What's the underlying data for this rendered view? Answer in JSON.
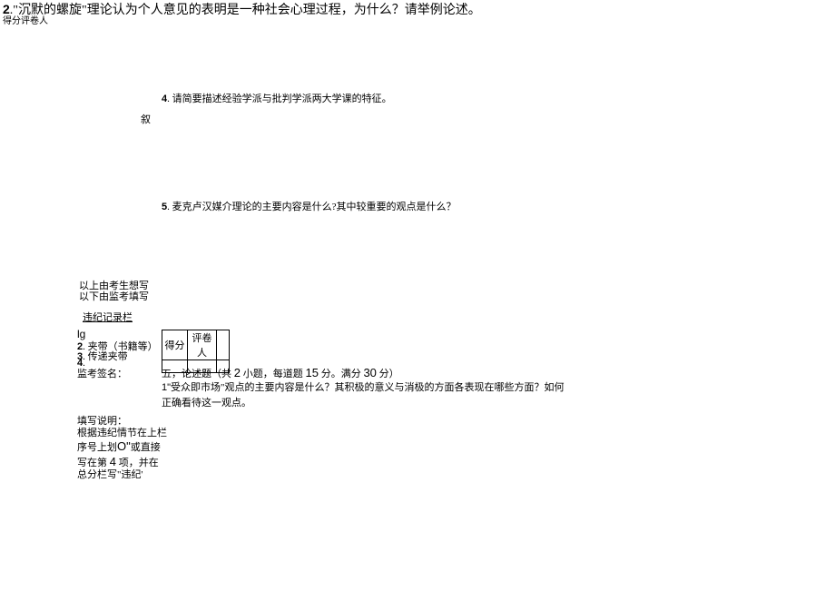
{
  "top": {
    "num": "2",
    "dot": ".",
    "text": "\"沉默的螺旋\"理论认为个人意见的表明是一种社会心理过程，为什么？请举例论述。"
  },
  "small_label": "得分评卷人",
  "q4": {
    "num": "4",
    "text": ". 请简要描述经验学派与批判学派两大学课的特征。"
  },
  "ji": "叙",
  "q5": {
    "num": "5",
    "text": ". 麦克卢汉媒介理论的主要内容是什么?其中较重要的观点是什么？"
  },
  "divider1": "以上由考生想写",
  "divider2": "以下由监考填写",
  "violation_header": "违纪记录栏",
  "lg": "lg",
  "item2": {
    "num": "2",
    "text": ". 夹带（书籍等）"
  },
  "item3": {
    "num": "3",
    "text": ". 传递夹带"
  },
  "item4": {
    "num": "4",
    "text": "."
  },
  "supervisor_sign": "监考签名：",
  "score_table": {
    "h1": "得分",
    "h2": "评卷人"
  },
  "section5": {
    "prefix": "五，论述题（共 ",
    "n1": "2",
    "mid1": " 小题，每道题 ",
    "n2": "15",
    "mid2": " 分。满分 ",
    "n3": "30",
    "suffix": " 分）"
  },
  "essay_q1": {
    "mark": "1\"",
    "line1": "受众即市场\"观点的主要内容是什么？其积极的意义与消极的方面各表现在哪些方面？如何",
    "line2": "正确看待这一观点。"
  },
  "fill_instructions": {
    "l1": "填写说明：",
    "l2_pre": "根据违纪情节在上栏序号上划",
    "l2_o": "O\"",
    "l2_mid": "或直接写在第 ",
    "l2_four": "4",
    "l2_post": " 项，并在总分栏写\"违纪'"
  }
}
